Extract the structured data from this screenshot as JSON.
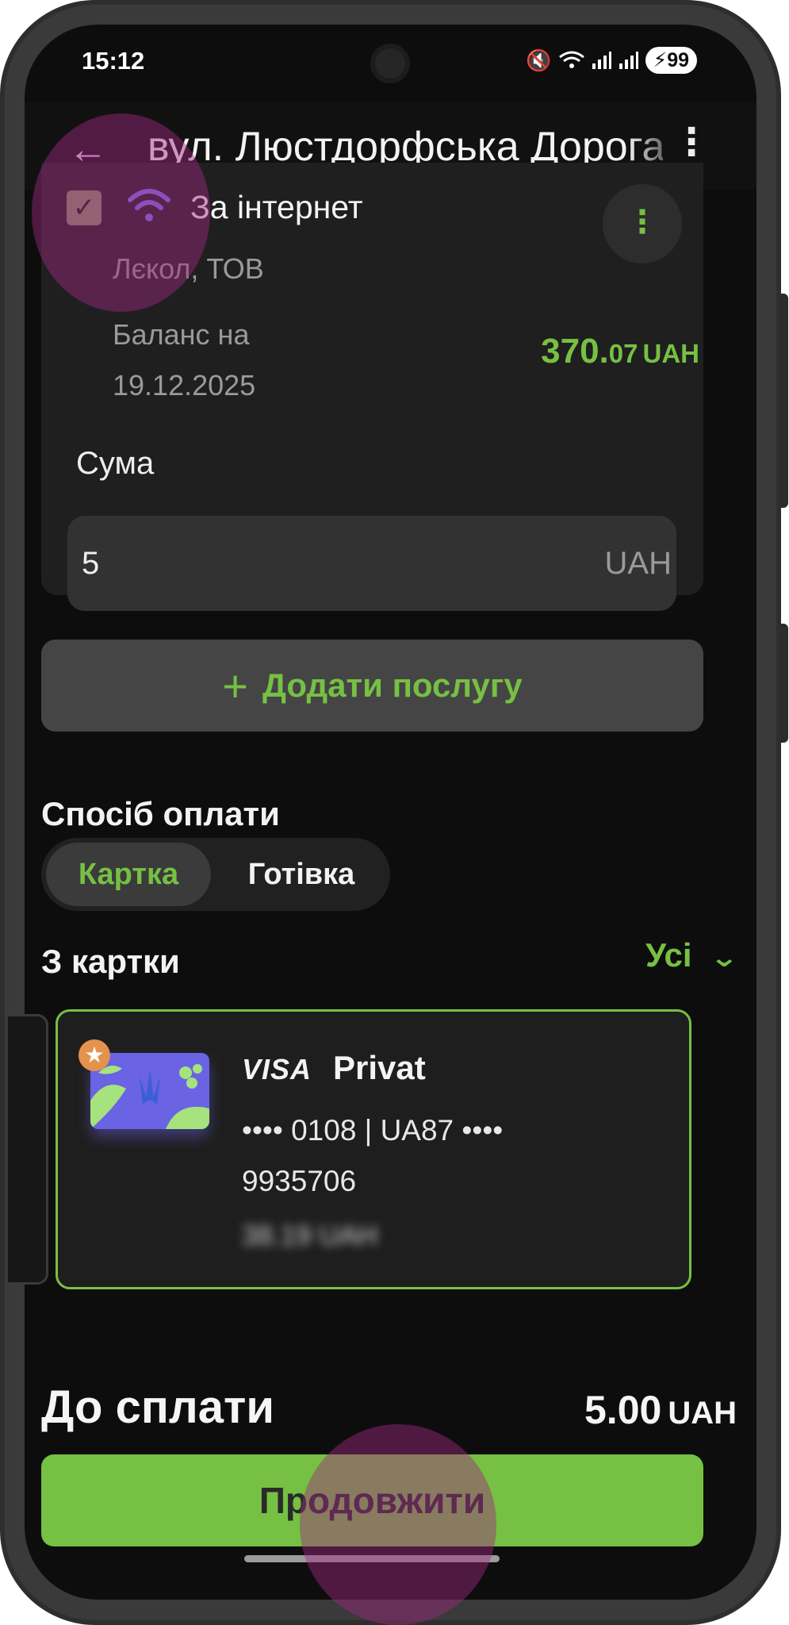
{
  "status_bar": {
    "time": "15:12",
    "battery": "99",
    "battery_icon": "bolt"
  },
  "app_bar": {
    "back_icon": "arrow-left-icon",
    "title": "вул. Люстдорфська Дорога",
    "menu_icon": "kebab-icon"
  },
  "service": {
    "checked": true,
    "name": "За інтернет",
    "provider": "Лєкол, ТОВ",
    "balance_label": "Баланс на 19.12.2025",
    "balance_integer": "370.",
    "balance_fraction": "07",
    "balance_currency": "UAH",
    "amount_label": "Сума",
    "amount_value": "5",
    "amount_currency": "UAH"
  },
  "add_service_label": "Додати послугу",
  "payment": {
    "title": "Спосіб оплати",
    "tabs": [
      "Картка",
      "Готівка"
    ],
    "active_tab": "Картка"
  },
  "from_card": {
    "title": "З картки",
    "all_link": "Усі"
  },
  "card": {
    "network": "VISA",
    "bank": "Privat",
    "number_line": "•••• 0108 | UA87 •••• 9935706",
    "balance_blurred": "38.19 UAH"
  },
  "total": {
    "label": "До сплати",
    "amount": "5.00",
    "currency": "UAH"
  },
  "continue_label": "Продовжити",
  "colors": {
    "accent": "#76c043",
    "background": "#0d0d0d",
    "card": "#1f1f1f"
  }
}
